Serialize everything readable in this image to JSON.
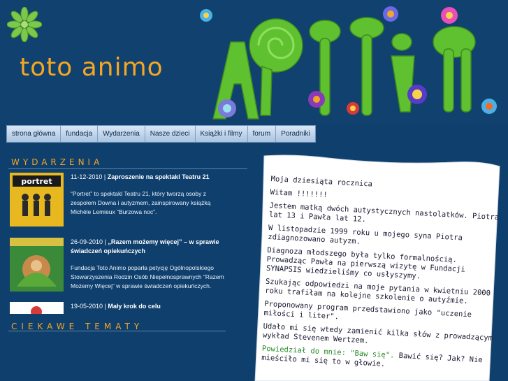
{
  "site": {
    "title": "toto animo"
  },
  "nav": {
    "items": [
      {
        "label": "strona główna"
      },
      {
        "label": "fundacja"
      },
      {
        "label": "Wydarzenia"
      },
      {
        "label": "Nasze dzieci"
      },
      {
        "label": "Książki i filmy"
      },
      {
        "label": "forum"
      },
      {
        "label": "Poradniki"
      }
    ]
  },
  "events": {
    "heading": "WYDARZENIA",
    "items": [
      {
        "date": "11-12-2010 |",
        "title": "Zaproszenie na spektakl Teatru 21",
        "body": "“Portret” to spektakl Teatru 21, który tworzą osoby z zespołem Downa i autyzmem, zainspirowany książką Michèle Lemieux “Burzowa noc”.",
        "thumb_label": "portret"
      },
      {
        "date": "26-09-2010 |",
        "title": "„Razem możemy więcej” – w sprawie świadczeń opiekuńczych",
        "body": "Fundacja Toto Animo poparła petycję Ogólnopolskiego Stowarzyszenia Rodzin Osób Niepełnosprawnych “Razem Możemy Więcej” w sprawie świadczeń opiekuńczych."
      },
      {
        "date": "19-05-2010 |",
        "title": "Mały krok do celu",
        "body": ""
      }
    ]
  },
  "topics": {
    "heading": "CIEKAWE TEMATY"
  },
  "letter": {
    "lines": [
      "Moja dziesiąta rocznica",
      "Witam !!!!!!!",
      "Jestem matką dwóch autystycznych nastolatków. Piotra lat 13 i Pawła lat 12.",
      "W listopadzie 1999 roku u mojego syna Piotra zdiagnozowano autyzm.",
      "Diagnoza młodszego była tylko formalnością. Prowadząc Pawła na pierwszą wizytę w Fundacji SYNAPSIS wiedzieliśmy co usłyszymy.",
      "Szukając odpowiedzi na moje pytania w kwietniu 2000 roku trafiłam na kolejne szkolenie o autyźmie.",
      "Proponowany program przedstawiono jako \"uczenie miłości i liter\".",
      "Udało mi się wtedy zamienić kilka słów z prowadzącym wykład Stevenem Wertzem."
    ],
    "green_prefix": "Powiedział do mnie: \"Baw się\".",
    "last_line": " Bawić się? Jak? Nie mieściło mi się to w głowie."
  },
  "colors": {
    "accent": "#f5a623",
    "background": "#0f3f6c",
    "nav": "#b9d1ea"
  }
}
